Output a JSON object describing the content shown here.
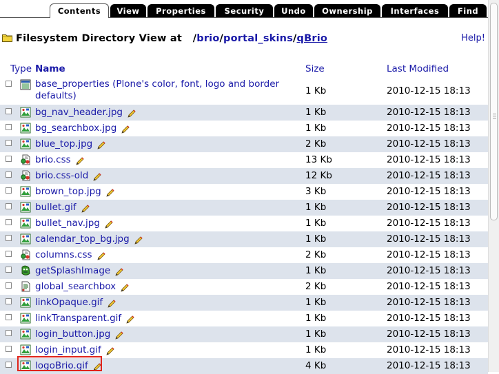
{
  "tabs": [
    "Contents",
    "View",
    "Properties",
    "Security",
    "Undo",
    "Ownership",
    "Interfaces",
    "Find"
  ],
  "header": {
    "prefix": "Filesystem Directory View at",
    "path_sep1": "/",
    "path_part1": "brio",
    "path_sep2": "/",
    "path_part2": "portal_skins",
    "path_sep3": "/",
    "path_part3": "qBrio",
    "help": "Help!"
  },
  "columns": {
    "type": "Type",
    "name": "Name",
    "size": "Size",
    "modified": "Last Modified"
  },
  "files": [
    {
      "name": "base_properties (Plone's color, font, logo and border defaults)",
      "size": "1 Kb",
      "modified": "2010-12-15 18:13",
      "icon": "properties-icon",
      "editable": false
    },
    {
      "name": "bg_nav_header.jpg",
      "size": "1 Kb",
      "modified": "2010-12-15 18:13",
      "icon": "image-icon",
      "editable": true
    },
    {
      "name": "bg_searchbox.jpg",
      "size": "1 Kb",
      "modified": "2010-12-15 18:13",
      "icon": "image-icon",
      "editable": true
    },
    {
      "name": "blue_top.jpg",
      "size": "2 Kb",
      "modified": "2010-12-15 18:13",
      "icon": "image-icon",
      "editable": true
    },
    {
      "name": "brio.css",
      "size": "13 Kb",
      "modified": "2010-12-15 18:13",
      "icon": "dtml-icon",
      "editable": true
    },
    {
      "name": "brio.css-old",
      "size": "12 Kb",
      "modified": "2010-12-15 18:13",
      "icon": "dtml-icon",
      "editable": true
    },
    {
      "name": "brown_top.jpg",
      "size": "3 Kb",
      "modified": "2010-12-15 18:13",
      "icon": "image-icon",
      "editable": true
    },
    {
      "name": "bullet.gif",
      "size": "1 Kb",
      "modified": "2010-12-15 18:13",
      "icon": "image-icon",
      "editable": true
    },
    {
      "name": "bullet_nav.jpg",
      "size": "1 Kb",
      "modified": "2010-12-15 18:13",
      "icon": "image-icon",
      "editable": true
    },
    {
      "name": "calendar_top_bg.jpg",
      "size": "1 Kb",
      "modified": "2010-12-15 18:13",
      "icon": "image-icon",
      "editable": true
    },
    {
      "name": "columns.css",
      "size": "2 Kb",
      "modified": "2010-12-15 18:13",
      "icon": "dtml-icon",
      "editable": true
    },
    {
      "name": "getSplashImage",
      "size": "1 Kb",
      "modified": "2010-12-15 18:13",
      "icon": "script-icon",
      "editable": true
    },
    {
      "name": "global_searchbox",
      "size": "2 Kb",
      "modified": "2010-12-15 18:13",
      "icon": "template-icon",
      "editable": true
    },
    {
      "name": "linkOpaque.gif",
      "size": "1 Kb",
      "modified": "2010-12-15 18:13",
      "icon": "image-icon",
      "editable": true
    },
    {
      "name": "linkTransparent.gif",
      "size": "1 Kb",
      "modified": "2010-12-15 18:13",
      "icon": "image-icon",
      "editable": true
    },
    {
      "name": "login_button.jpg",
      "size": "1 Kb",
      "modified": "2010-12-15 18:13",
      "icon": "image-icon",
      "editable": true
    },
    {
      "name": "login_input.gif",
      "size": "1 Kb",
      "modified": "2010-12-15 18:13",
      "icon": "image-icon",
      "editable": true
    },
    {
      "name": "logoBrio.gif",
      "size": "4 Kb",
      "modified": "2010-12-15 18:13",
      "icon": "image-icon",
      "editable": true,
      "highlighted": true
    }
  ],
  "colors": {
    "link": "#1a1aa8",
    "row_alt": "#dde3ec",
    "highlight": "#e0241b"
  }
}
